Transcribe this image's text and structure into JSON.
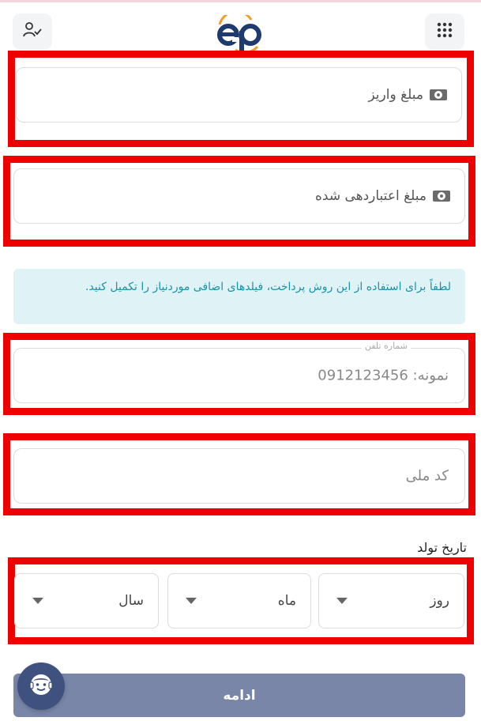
{
  "header": {
    "logo_text": "ep",
    "user_icon": "user-check-icon",
    "menu_icon": "grid-menu-icon"
  },
  "fields": {
    "deposit_amount": {
      "label": "مبلغ واریز",
      "icon": "cash-icon"
    },
    "credited_amount": {
      "label": "مبلغ اعتباردهی شده",
      "icon": "cash-icon"
    }
  },
  "notice": {
    "text": "لطفاً برای استفاده از این روش پرداخت، فیلدهای اضافی موردنیاز را تکمیل کنید."
  },
  "phone": {
    "label": "شماره تلفن",
    "placeholder": "نمونه: 0912123456"
  },
  "national_code": {
    "placeholder": "کد ملی"
  },
  "birth_date": {
    "title": "تاریخ تولد",
    "day": "روز",
    "month": "ماه",
    "year": "سال"
  },
  "actions": {
    "continue_label": "ادامه"
  },
  "colors": {
    "highlight_frame": "#ee0000",
    "info_bg": "#dff2f5",
    "info_text": "#1a93a8",
    "button_bg": "#7986a8",
    "fab_bg": "#3f517e",
    "logo_blue": "#1f3a6e",
    "logo_orange": "#f39c2b"
  }
}
